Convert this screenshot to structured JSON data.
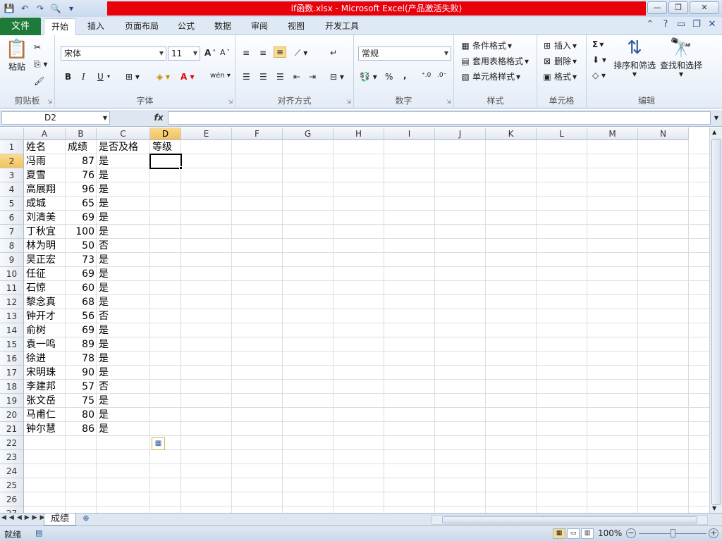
{
  "window": {
    "title": "if函数.xlsx - Microsoft Excel(产品激活失败)",
    "minimize": "—",
    "restore": "❐",
    "close": "✕"
  },
  "qat": {
    "save": "💾",
    "undo": "↶",
    "redo": "↷",
    "preview": "🔍",
    "customize": "▾"
  },
  "tabs": {
    "file": "文件",
    "items": [
      "开始",
      "插入",
      "页面布局",
      "公式",
      "数据",
      "审阅",
      "视图",
      "开发工具"
    ]
  },
  "ribbon": {
    "clipboard": {
      "label": "剪贴板",
      "paste": "粘贴"
    },
    "font": {
      "label": "字体",
      "name": "宋体",
      "size": "11",
      "bold": "B",
      "italic": "I",
      "underline": "U"
    },
    "alignment": {
      "label": "对齐方式"
    },
    "number": {
      "label": "数字",
      "format": "常规",
      "percent": "%",
      "comma": ","
    },
    "styles": {
      "label": "样式",
      "conditional": "条件格式",
      "table": "套用表格格式",
      "cell": "单元格样式"
    },
    "cells": {
      "label": "单元格",
      "insert": "插入",
      "delete": "删除",
      "format": "格式"
    },
    "editing": {
      "label": "编辑",
      "sort": "排序和筛选",
      "find": "查找和选择",
      "sum": "Σ"
    }
  },
  "formula_bar": {
    "name_box": "D2",
    "fx": "fx",
    "formula": ""
  },
  "grid": {
    "columns": [
      "A",
      "B",
      "C",
      "D",
      "E",
      "F",
      "G",
      "H",
      "I",
      "J",
      "K",
      "L",
      "M",
      "N"
    ],
    "rows": [
      "1",
      "2",
      "3",
      "4",
      "5",
      "6",
      "7",
      "8",
      "9",
      "10",
      "11",
      "12",
      "13",
      "14",
      "15",
      "16",
      "17",
      "18",
      "19",
      "20",
      "21",
      "22",
      "23",
      "24",
      "25",
      "26",
      "27"
    ],
    "header": [
      "姓名",
      "成绩",
      "是否及格",
      "等级"
    ],
    "data": [
      [
        "冯雨",
        "87",
        "是"
      ],
      [
        "夏雪",
        "76",
        "是"
      ],
      [
        "高展翔",
        "96",
        "是"
      ],
      [
        "成城",
        "65",
        "是"
      ],
      [
        "刘清美",
        "69",
        "是"
      ],
      [
        "丁秋宜",
        "100",
        "是"
      ],
      [
        "林为明",
        "50",
        "否"
      ],
      [
        "吴正宏",
        "73",
        "是"
      ],
      [
        "任征",
        "69",
        "是"
      ],
      [
        "石惊",
        "60",
        "是"
      ],
      [
        "黎念真",
        "68",
        "是"
      ],
      [
        "钟开才",
        "56",
        "否"
      ],
      [
        "俞树",
        "69",
        "是"
      ],
      [
        "袁一鸣",
        "89",
        "是"
      ],
      [
        "徐进",
        "78",
        "是"
      ],
      [
        "宋明珠",
        "90",
        "是"
      ],
      [
        "李建邦",
        "57",
        "否"
      ],
      [
        "张文岳",
        "75",
        "是"
      ],
      [
        "马甫仁",
        "80",
        "是"
      ],
      [
        "钟尔慧",
        "86",
        "是"
      ]
    ],
    "selected_cell": "D2"
  },
  "sheets": {
    "active": "成绩"
  },
  "status": {
    "text": "就绪",
    "zoom": "100%",
    "minus": "−",
    "plus": "+"
  },
  "colors": {
    "file_tab": "#1e7a38",
    "title_bar": "#e8000b",
    "selection_header": "#f1c15e"
  }
}
